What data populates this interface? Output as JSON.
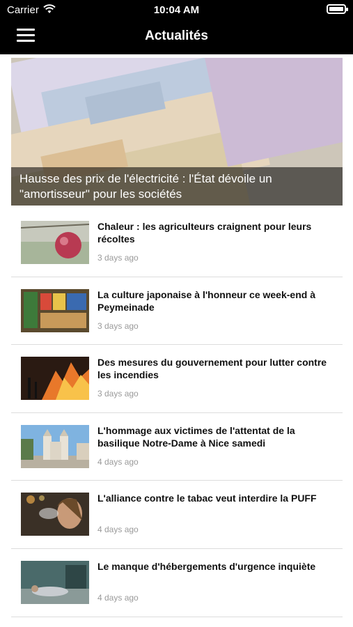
{
  "status_bar": {
    "carrier": "Carrier",
    "time": "10:04 AM"
  },
  "header": {
    "title": "Actualités",
    "menu_icon": "hamburger-menu-icon"
  },
  "featured": {
    "title": "Hausse des prix de l'électricité : l'État dévoile un \"amortisseur\" pour les sociétés",
    "image": "euro-banknotes"
  },
  "articles": [
    {
      "title": "Chaleur : les agriculteurs craignent pour leurs récoltes",
      "time": "3 days ago",
      "image": "apple-tree"
    },
    {
      "title": "La culture japonaise à l'honneur ce week-end à Peymeinade",
      "time": "3 days ago",
      "image": "japanese-shop"
    },
    {
      "title": "Des mesures du gouvernement pour lutter contre les incendies",
      "time": "3 days ago",
      "image": "forest-fire"
    },
    {
      "title": "L'hommage aux victimes de l'attentat de la basilique Notre-Dame à Nice samedi",
      "time": "4 days ago",
      "image": "basilica"
    },
    {
      "title": "L'alliance contre le tabac veut interdire la PUFF",
      "time": "4 days ago",
      "image": "person-vaping"
    },
    {
      "title": "Le manque d'hébergements d'urgence inquiète",
      "time": "4 days ago",
      "image": "homeless-person"
    }
  ],
  "colors": {
    "header_bg": "#000000",
    "header_text": "#ffffff",
    "timestamp": "#9a9a9a",
    "divider": "#dcdcdc"
  }
}
